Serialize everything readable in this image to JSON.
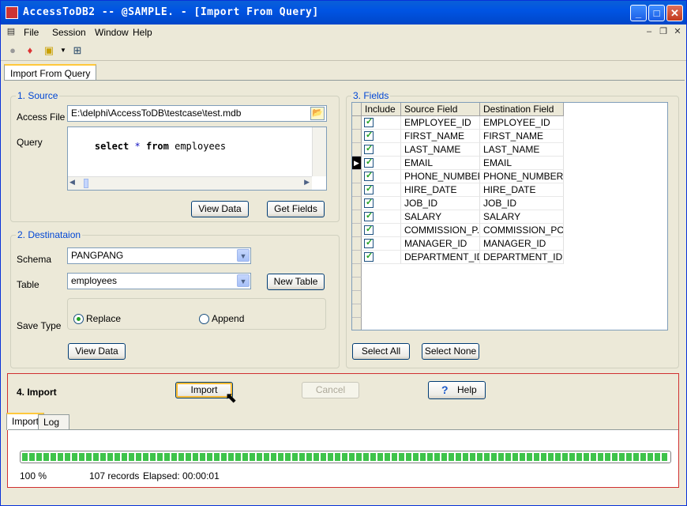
{
  "window": {
    "title": "AccessToDB2 -- @SAMPLE. - [Import From Query]"
  },
  "menu": [
    "File",
    "Session",
    "Window",
    "Help"
  ],
  "doc_tab": "Import From Query",
  "source": {
    "title": "1. Source",
    "access_file_label": "Access File",
    "access_file_value": "E:\\delphi\\AccessToDB\\testcase\\test.mdb",
    "query_label": "Query",
    "query": {
      "kw1": "select",
      "star": "*",
      "kw2": "from",
      "table": "employees"
    },
    "view_data": "View Data",
    "get_fields": "Get Fields"
  },
  "destination": {
    "title": "2. Destinataion",
    "schema_label": "Schema",
    "schema_value": "PANGPANG",
    "table_label": "Table",
    "table_value": "employees",
    "new_table": "New Table",
    "save_type_label": "Save Type",
    "replace": "Replace",
    "append": "Append",
    "save_type_selected": "Replace",
    "view_data": "View Data"
  },
  "fields": {
    "title": "3. Fields",
    "columns": [
      "Include",
      "Source Field",
      "Destination Field"
    ],
    "rows": [
      {
        "include": true,
        "source": "EMPLOYEE_ID",
        "dest": "EMPLOYEE_ID"
      },
      {
        "include": true,
        "source": "FIRST_NAME",
        "dest": "FIRST_NAME"
      },
      {
        "include": true,
        "source": "LAST_NAME",
        "dest": "LAST_NAME"
      },
      {
        "include": true,
        "source": "EMAIL",
        "dest": "EMAIL"
      },
      {
        "include": true,
        "source": "PHONE_NUMBER",
        "dest": "PHONE_NUMBER"
      },
      {
        "include": true,
        "source": "HIRE_DATE",
        "dest": "HIRE_DATE"
      },
      {
        "include": true,
        "source": "JOB_ID",
        "dest": "JOB_ID"
      },
      {
        "include": true,
        "source": "SALARY",
        "dest": "SALARY"
      },
      {
        "include": true,
        "source": "COMMISSION_P...",
        "dest": "COMMISSION_PCT"
      },
      {
        "include": true,
        "source": "MANAGER_ID",
        "dest": "MANAGER_ID"
      },
      {
        "include": true,
        "source": "DEPARTMENT_ID",
        "dest": "DEPARTMENT_ID"
      }
    ],
    "select_all": "Select All",
    "select_none": "Select None"
  },
  "import": {
    "title": "4. Import",
    "import_btn": "Import",
    "cancel_btn": "Cancel",
    "help_btn": "Help",
    "tabs": [
      "Import",
      "Log"
    ],
    "progress_percent": "100 %",
    "progress_fraction": 1.0,
    "records": "107 records",
    "elapsed": "Elapsed: 00:00:01"
  },
  "colors": {
    "group_title": "#0046d5",
    "titlebar": "#0054e3",
    "progress": "#3ec34a",
    "import_border": "#d03030"
  }
}
